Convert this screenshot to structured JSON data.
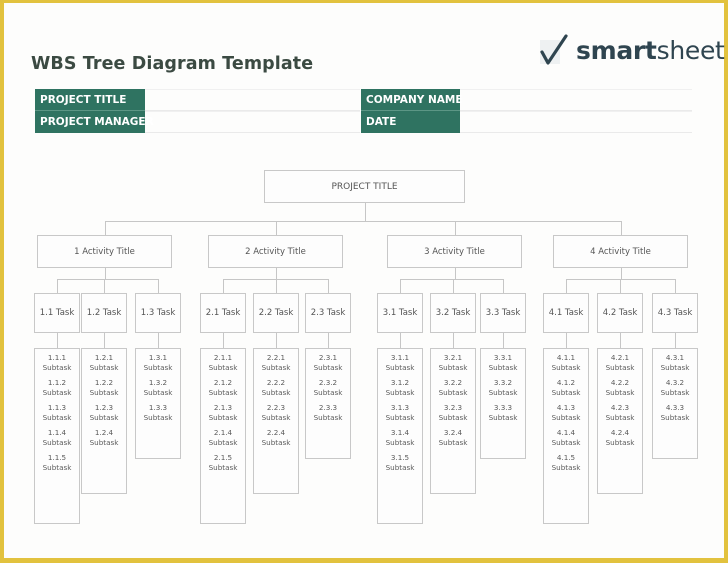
{
  "header": {
    "title": "WBS Tree Diagram Template",
    "logo": {
      "icon": "checkmark-icon",
      "bold_text": "smart",
      "light_text": "sheet"
    }
  },
  "info_fields": [
    {
      "label": "PROJECT TITLE",
      "value": ""
    },
    {
      "label": "PROJECT MANAGER",
      "value": ""
    },
    {
      "label": "COMPANY NAME",
      "value": ""
    },
    {
      "label": "DATE",
      "value": ""
    }
  ],
  "colors": {
    "accent": "#2f7361",
    "frame": "#e2c23e",
    "box_border": "#c8c8c8"
  },
  "tree": {
    "root": "PROJECT TITLE",
    "activities": [
      {
        "label": "1 Activity Title",
        "tasks": [
          {
            "label": "1.1 Task",
            "subtasks": [
              "1.1.1 Subtask",
              "1.1.2 Subtask",
              "1.1.3 Subtask",
              "1.1.4 Subtask",
              "1.1.5 Subtask"
            ]
          },
          {
            "label": "1.2 Task",
            "subtasks": [
              "1.2.1 Subtask",
              "1.2.2 Subtask",
              "1.2.3 Subtask",
              "1.2.4 Subtask"
            ]
          },
          {
            "label": "1.3 Task",
            "subtasks": [
              "1.3.1 Subtask",
              "1.3.2 Subtask",
              "1.3.3 Subtask"
            ]
          }
        ]
      },
      {
        "label": "2 Activity Title",
        "tasks": [
          {
            "label": "2.1 Task",
            "subtasks": [
              "2.1.1 Subtask",
              "2.1.2 Subtask",
              "2.1.3 Subtask",
              "2.1.4 Subtask",
              "2.1.5 Subtask"
            ]
          },
          {
            "label": "2.2 Task",
            "subtasks": [
              "2.2.1 Subtask",
              "2.2.2 Subtask",
              "2.2.3 Subtask",
              "2.2.4 Subtask"
            ]
          },
          {
            "label": "2.3 Task",
            "subtasks": [
              "2.3.1 Subtask",
              "2.3.2 Subtask",
              "2.3.3 Subtask"
            ]
          }
        ]
      },
      {
        "label": "3 Activity Title",
        "tasks": [
          {
            "label": "3.1 Task",
            "subtasks": [
              "3.1.1 Subtask",
              "3.1.2 Subtask",
              "3.1.3 Subtask",
              "3.1.4 Subtask",
              "3.1.5 Subtask"
            ]
          },
          {
            "label": "3.2 Task",
            "subtasks": [
              "3.2.1 Subtask",
              "3.2.2 Subtask",
              "3.2.3 Subtask",
              "3.2.4 Subtask"
            ]
          },
          {
            "label": "3.3 Task",
            "subtasks": [
              "3.3.1 Subtask",
              "3.3.2 Subtask",
              "3.3.3 Subtask"
            ]
          }
        ]
      },
      {
        "label": "4 Activity Title",
        "tasks": [
          {
            "label": "4.1 Task",
            "subtasks": [
              "4.1.1 Subtask",
              "4.1.2 Subtask",
              "4.1.3 Subtask",
              "4.1.4 Subtask",
              "4.1.5 Subtask"
            ]
          },
          {
            "label": "4.2 Task",
            "subtasks": [
              "4.2.1 Subtask",
              "4.2.2 Subtask",
              "4.2.3 Subtask",
              "4.2.4 Subtask"
            ]
          },
          {
            "label": "4.3 Task",
            "subtasks": [
              "4.3.1 Subtask",
              "4.3.2 Subtask",
              "4.3.3 Subtask"
            ]
          }
        ]
      }
    ]
  }
}
